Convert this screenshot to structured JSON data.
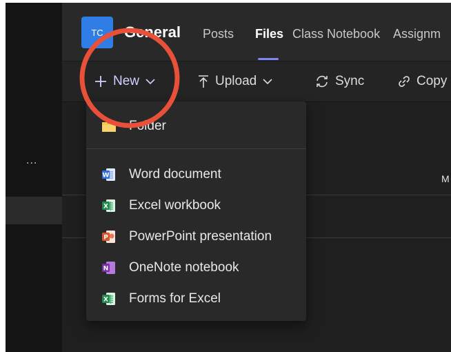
{
  "left_rail": {
    "more_label": "..."
  },
  "header": {
    "avatar_initials": "TC",
    "channel_title": "General",
    "tabs": [
      {
        "label": "Posts",
        "active": false
      },
      {
        "label": "Files",
        "active": true
      },
      {
        "label": "Class Notebook",
        "active": false
      },
      {
        "label": "Assignm",
        "active": false
      }
    ]
  },
  "toolbar": {
    "new_label": "New",
    "upload_label": "Upload",
    "sync_label": "Sync",
    "copy_label": "Copy"
  },
  "file_list": {
    "column_header_partial": "M"
  },
  "new_menu": {
    "items": [
      {
        "label": "Folder",
        "icon": "folder-icon",
        "color": "#f4c84a"
      },
      {
        "label": "Word document",
        "icon": "word-icon",
        "color": "#2f6fe0"
      },
      {
        "label": "Excel workbook",
        "icon": "excel-icon",
        "color": "#1f8a4c"
      },
      {
        "label": "PowerPoint presentation",
        "icon": "powerpoint-icon",
        "color": "#d9542b"
      },
      {
        "label": "OneNote notebook",
        "icon": "onenote-icon",
        "color": "#8a3fb8"
      },
      {
        "label": "Forms for Excel",
        "icon": "forms-for-excel-icon",
        "color": "#1f8a4c"
      }
    ]
  },
  "colors": {
    "accent": "#7f85f5",
    "annotation_circle": "#e8503a",
    "avatar": "#2f7ee6"
  }
}
